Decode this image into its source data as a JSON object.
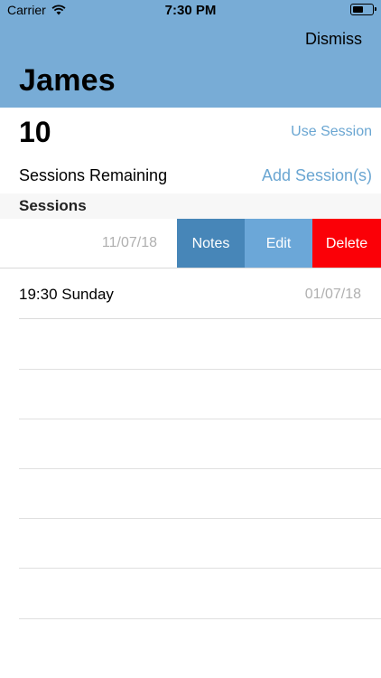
{
  "status_bar": {
    "carrier": "Carrier",
    "time": "7:30 PM"
  },
  "header": {
    "dismiss_label": "Dismiss",
    "title": "James"
  },
  "summary": {
    "count": "10",
    "use_session_label": "Use Session",
    "remaining_label": "Sessions Remaining",
    "add_session_label": "Add Session(s)"
  },
  "sessions": {
    "section_title": "Sessions",
    "swiped_row": {
      "date": "11/07/18"
    },
    "actions": {
      "notes": "Notes",
      "edit": "Edit",
      "delete": "Delete"
    },
    "items": [
      {
        "title": "19:30 Sunday",
        "date": "01/07/18"
      }
    ]
  },
  "colors": {
    "header_bg": "#78acd6",
    "link": "#6aa6d2",
    "notes": "#4786b8",
    "edit": "#6ba7d8",
    "delete": "#fb0007"
  }
}
